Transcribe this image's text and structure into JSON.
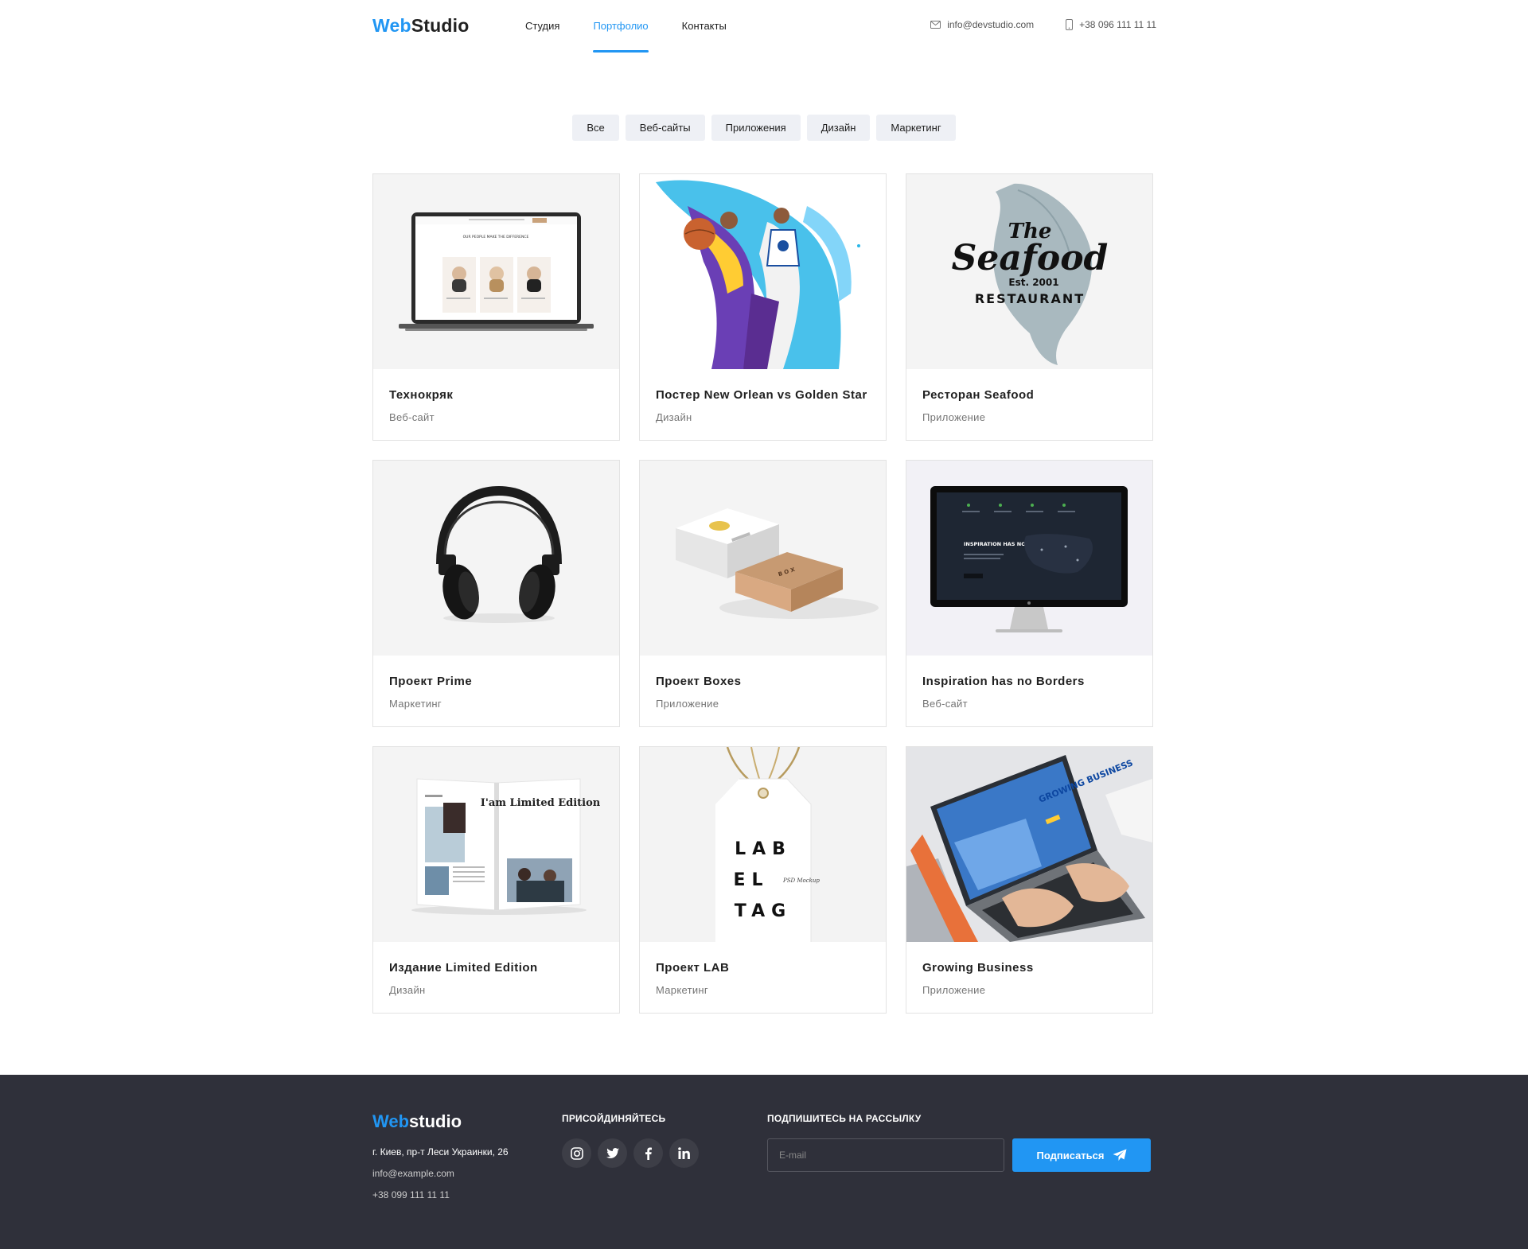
{
  "header": {
    "logo_part1": "Web",
    "logo_part2": "Studio",
    "nav": [
      "Студия",
      "Портфолио",
      "Контакты"
    ],
    "email": "info@devstudio.com",
    "phone": "+38 096 111 11 11",
    "icons": [
      "envelope-icon",
      "phone-icon"
    ]
  },
  "filters": [
    "Все",
    "Веб-сайты",
    "Приложения",
    "Дизайн",
    "Маркетинг"
  ],
  "portfolio": [
    {
      "title": "Технокряк",
      "category": "Веб-сайт"
    },
    {
      "title": "Постер New Orlean vs Golden Star",
      "category": "Дизайн"
    },
    {
      "title": "Ресторан Seafood",
      "category": "Приложение"
    },
    {
      "title": "Проект Prime",
      "category": "Маркетинг"
    },
    {
      "title": "Проект Boxes",
      "category": "Приложение"
    },
    {
      "title": "Inspiration has no Borders",
      "category": "Веб-сайт"
    },
    {
      "title": "Издание Limited Edition",
      "category": "Дизайн"
    },
    {
      "title": "Проект LAB",
      "category": "Маркетинг"
    },
    {
      "title": "Growing Business",
      "category": "Приложение"
    }
  ],
  "thumb_text": {
    "seafood_the": "The",
    "seafood_name": "Seafood",
    "seafood_est": "Est. 2001",
    "seafood_restaurant": "RESTAURANT",
    "monitor_heading": "INSPIRATION HAS NO BORDERS",
    "magazine_title": "I'am Limited Edition",
    "tag_line1": "LAB",
    "tag_line2": "EL",
    "tag_line3": "TAG",
    "tag_sub": "PSD Mockup",
    "laptop_screen": "GROWING BUSINESS",
    "laptop_team_heading": "OUR PEOPLE MAKE THE DIFFERENCE"
  },
  "footer": {
    "logo_part1": "Web",
    "logo_part2": "studio",
    "address": "г. Киев, пр-т Леси Украинки, 26",
    "email": "info@example.com",
    "phone": "+38 099 111 11 11",
    "join_heading": "ПРИСОЙДИНЯЙТЕСЬ",
    "social_icons": [
      "instagram-icon",
      "twitter-icon",
      "facebook-icon",
      "linkedin-icon"
    ],
    "subscribe_heading": "ПОДПИШИТЕСЬ НА РАССЫЛКУ",
    "email_placeholder": "E-mail",
    "subscribe_button": "Подписаться"
  },
  "colors": {
    "accent": "#2196F3",
    "text": "#212121",
    "muted": "#757575",
    "footer_bg": "#2f303a",
    "filter_bg": "#eef0f5"
  }
}
